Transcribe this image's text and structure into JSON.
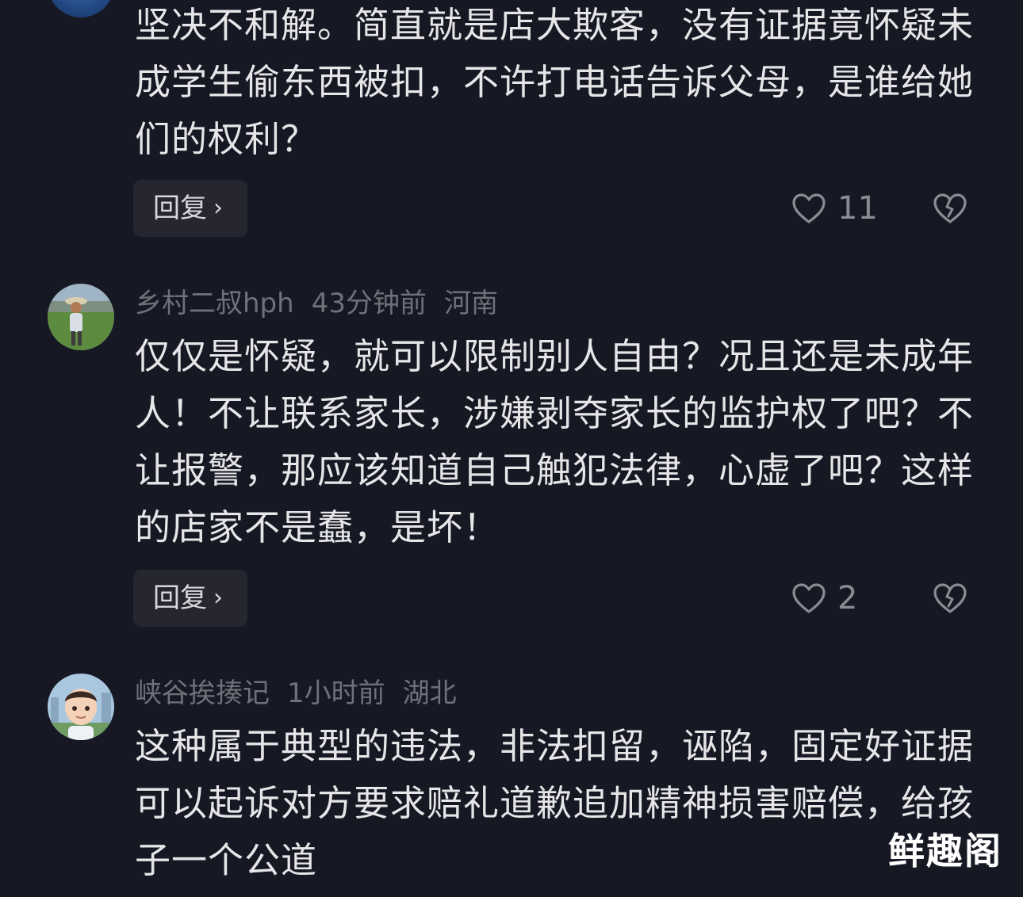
{
  "comments": [
    {
      "user": "",
      "time": "",
      "location": "",
      "text": "坚决不和解。简直就是店大欺客，没有证据竟怀疑未成学生偷东西被扣，不许打电话告诉父母，是谁给她们的权利？",
      "reply_label": "回复",
      "likes": "11"
    },
    {
      "user": "乡村二叔hph",
      "time": "43分钟前",
      "location": "河南",
      "text": "仅仅是怀疑，就可以限制别人自由？况且还是未成年人！不让联系家长，涉嫌剥夺家长的监护权了吧？不让报警，那应该知道自己触犯法律，心虚了吧？这样的店家不是蠢，是坏！",
      "reply_label": "回复",
      "likes": "2"
    },
    {
      "user": "峡谷挨揍记",
      "time": "1小时前",
      "location": "湖北",
      "text": "这种属于典型的违法，非法扣留，诬陷，固定好证据可以起诉对方要求赔礼道歉追加精神损害赔偿，给孩子一个公道"
    }
  ],
  "watermark": "鲜趣阁",
  "icons": {
    "like": "heart-outline-icon",
    "dislike": "broken-heart-icon",
    "chevron": "chevron-right-icon"
  }
}
